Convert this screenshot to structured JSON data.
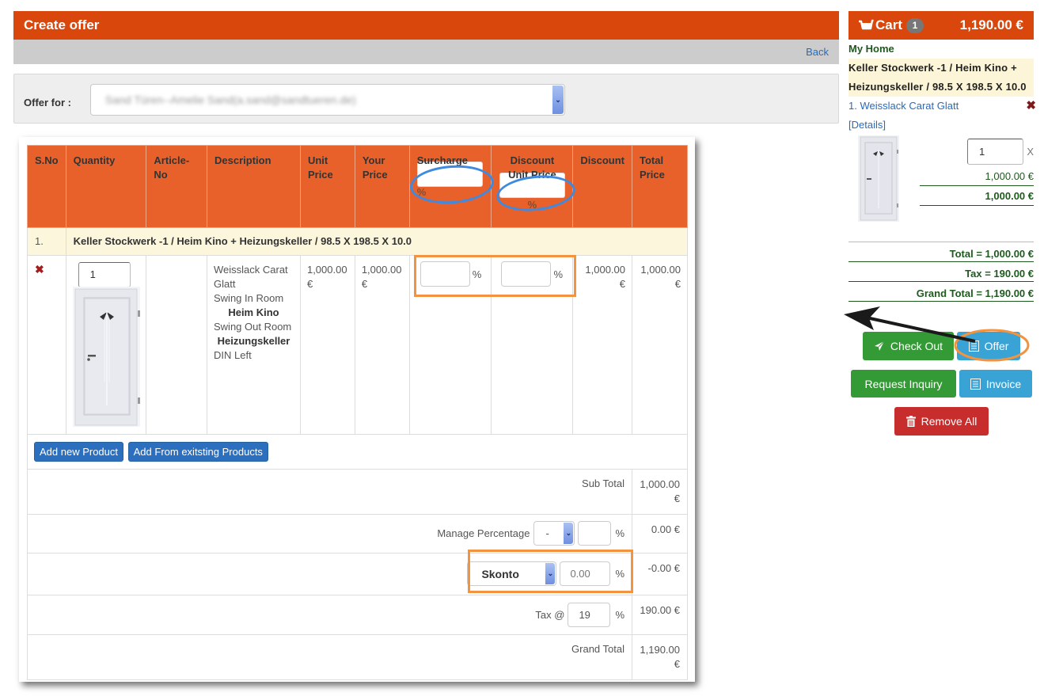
{
  "page": {
    "title": "Create offer",
    "back_label": "Back"
  },
  "offer_for": {
    "label": "Offer for :",
    "selected_value": "Sand Türen--Amelie Sand(a.sand@sandtueren.de)"
  },
  "table": {
    "headers": {
      "sno": "S.No",
      "quantity": "Quantity",
      "article_no": "Article-No",
      "description": "Description",
      "unit_price": "Unit Price",
      "your_price": "Your Price",
      "surcharge": "Surcharge",
      "surcharge_unit": "%",
      "discount_unit_price": "Discount Unit Price",
      "discount_unit_price_unit": "%",
      "discount": "Discount",
      "total_price": "Total Price"
    },
    "group": {
      "number": "1.",
      "title": "Keller Stockwerk -1 / Heim Kino + Heizungskeller / 98.5 X 198.5 X 10.0"
    },
    "item": {
      "quantity": "1",
      "article_no": "",
      "description": {
        "name": "Weisslack Carat Glatt",
        "swing_in_label": "Swing In Room",
        "swing_in_room": "Heim Kino",
        "swing_out_label": "Swing Out Room",
        "swing_out_room": "Heizungskeller",
        "din": "DIN Left"
      },
      "unit_price": "1,000.00 €",
      "your_price": "1,000.00 €",
      "surcharge_value": "",
      "surcharge_unit": "%",
      "discount_unit_value": "",
      "discount_unit_unit": "%",
      "discount": "1,000.00 €",
      "total_price": "1,000.00 €",
      "remove_icon": "close-icon"
    },
    "buttons": {
      "add_new": "Add new Product",
      "add_existing": "Add From exitsting Products"
    },
    "summary": {
      "subtotal_label": "Sub Total",
      "subtotal_value": "1,000.00 €",
      "manage_percentage_label": "Manage Percentage",
      "manage_percentage_sign": "-",
      "manage_percentage_value": "",
      "manage_percentage_unit": "%",
      "manage_percentage_amount": "0.00 €",
      "skonto_option": "Skonto",
      "skonto_value": "0.00",
      "skonto_unit": "%",
      "skonto_amount": "-0.00 €",
      "tax_label": "Tax @",
      "tax_value": "19",
      "tax_unit": "%",
      "tax_amount": "190.00 €",
      "grand_total_label": "Grand Total",
      "grand_total_value": "1,190.00 €"
    }
  },
  "cart": {
    "title": "Cart",
    "count": "1",
    "total": "1,190.00 €",
    "project": "My Home",
    "group_title": "Keller Stockwerk -1 / Heim Kino + Heizungskeller / 98.5 X 198.5 X 10.0",
    "item_label": "1. Weisslack Carat Glatt",
    "details_label": "[Details]",
    "quantity": "1",
    "times": "X",
    "unit_price": "1,000.00 €",
    "line_total": "1,000.00 €",
    "total_row": "Total = 1,000.00 €",
    "tax_row": "Tax = 190.00 €",
    "grand_total_row": "Grand Total = 1,190.00 €",
    "buttons": {
      "checkout": "Check Out",
      "offer": "Offer",
      "request_inquiry": "Request Inquiry",
      "invoice": "Invoice",
      "remove_all": "Remove All"
    }
  },
  "colors": {
    "brand_orange": "#d9470c",
    "table_header": "#e8612a",
    "group_row_bg": "#fcf7dc",
    "annotation_orange": "#f3933f",
    "annotation_blue": "#3d8ae0",
    "success_green": "#349a35",
    "info_cyan": "#3aa3d6",
    "danger_red": "#c72d2d",
    "link_blue": "#2a6ab8",
    "dark_green_text": "#1e5a1e"
  }
}
